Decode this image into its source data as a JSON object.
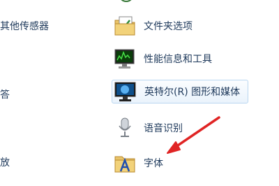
{
  "left_items": [
    "其他传感器",
    "答",
    "放"
  ],
  "items": [
    {
      "label": "文件夹选项",
      "icon": "folder-options-icon"
    },
    {
      "label": "性能信息和工具",
      "icon": "performance-tools-icon"
    },
    {
      "label": "英特尔(R) 图形和媒体",
      "icon": "intel-graphics-icon"
    },
    {
      "label": "语音识别",
      "icon": "microphone-icon"
    },
    {
      "label": "字体",
      "icon": "fonts-folder-icon"
    }
  ],
  "colors": {
    "text": "#1e395b",
    "arrow": "#e02424",
    "hover_border": "#b9d6f0"
  }
}
